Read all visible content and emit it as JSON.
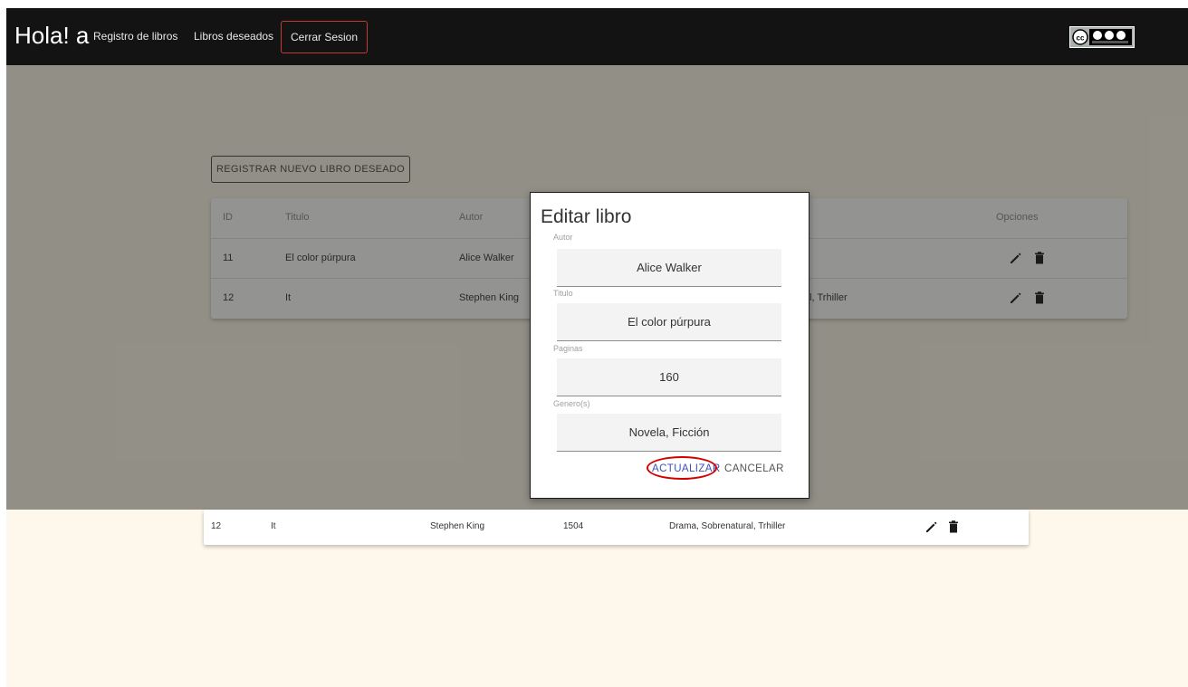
{
  "navbar": {
    "brand": "Hola! a",
    "links": [
      "Registro de libros",
      "Libros deseados"
    ],
    "logout_label": "Cerrar Sesion",
    "license_logo": "cc-by-nc-sa-logo"
  },
  "page": {
    "register_button": "REGISTRAR NUEVO LIBRO DESEADO",
    "table": {
      "headers": {
        "id": "ID",
        "title": "Titulo",
        "author": "Autor",
        "options": "Opciones"
      },
      "rows": [
        {
          "id": "11",
          "title": "El color púrpura",
          "author": "Alice Walker",
          "genres": ""
        },
        {
          "id": "12",
          "title": "It",
          "author": "Stephen King",
          "genres": "al, Trhiller"
        }
      ]
    },
    "table_lower": {
      "row": {
        "id": "12",
        "title": "It",
        "author": "Stephen King",
        "pages": "1504",
        "genres": "Drama, Sobrenatural, Trhiller"
      }
    },
    "icons": {
      "edit": "pencil-icon",
      "delete": "trash-icon"
    }
  },
  "modal": {
    "title": "Editar libro",
    "fields": {
      "author": {
        "label": "Autor",
        "value": "Alice Walker"
      },
      "title": {
        "label": "Titulo",
        "value": "El color púrpura"
      },
      "pages": {
        "label": "Paginas",
        "value": "160"
      },
      "genres": {
        "label": "Genero(s)",
        "value": "Novela, Ficción"
      }
    },
    "update_label": "ACTUALIZAR",
    "cancel_label": "CANCELAR"
  },
  "colors": {
    "navbar": "#131313",
    "page_background": "#fdf8eb",
    "logout_border": "#c43a32",
    "highlight": "#d40000",
    "primary_button": "#3f51b5"
  }
}
